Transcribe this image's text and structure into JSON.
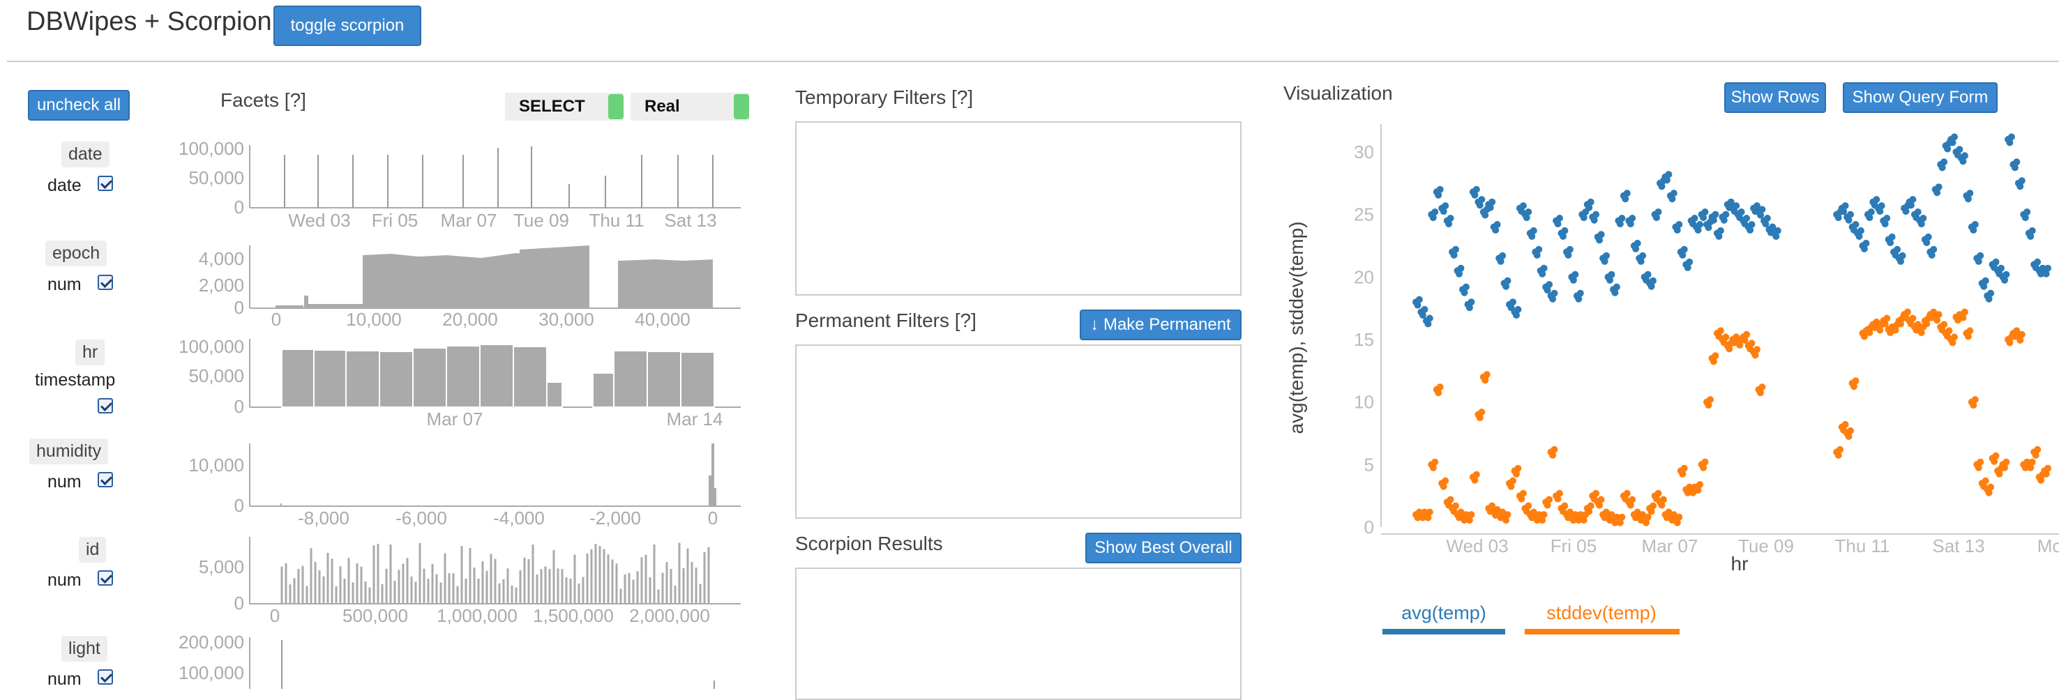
{
  "header": {
    "app_title": "DBWipes + Scorpion!",
    "toggle_button": "toggle scorpion"
  },
  "facets": {
    "uncheck_all": "uncheck all",
    "title": "Facets [?]",
    "select_toggle": "SELECT",
    "real_toggle": "Real",
    "rows": [
      {
        "name": "date",
        "type": "date",
        "checked": true,
        "yticks": [
          "100,000",
          "50,000",
          "0"
        ],
        "xticks": [
          "Wed 03",
          "Fri 05",
          "Mar 07",
          "Tue 09",
          "Thu 11",
          "Sat 13"
        ]
      },
      {
        "name": "epoch",
        "type": "num",
        "checked": true,
        "yticks": [
          "4,000",
          "2,000",
          "0"
        ],
        "xticks": [
          "0",
          "10,000",
          "20,000",
          "30,000",
          "40,000"
        ]
      },
      {
        "name": "hr",
        "type": "timestamp",
        "checked": true,
        "yticks": [
          "100,000",
          "50,000",
          "0"
        ],
        "xticks": [
          "Mar 07",
          "Mar 14"
        ]
      },
      {
        "name": "humidity",
        "type": "num",
        "checked": true,
        "yticks": [
          "10,000",
          "0"
        ],
        "xticks": [
          "-8,000",
          "-6,000",
          "-4,000",
          "-2,000",
          "0"
        ]
      },
      {
        "name": "id",
        "type": "num",
        "checked": true,
        "yticks": [
          "5,000",
          "0"
        ],
        "xticks": [
          "0",
          "500,000",
          "1,000,000",
          "1,500,000",
          "2,000,000"
        ]
      },
      {
        "name": "light",
        "type": "num",
        "checked": true,
        "yticks": [
          "200,000",
          "100,000"
        ],
        "xticks": []
      }
    ]
  },
  "filters": {
    "temporary_title": "Temporary Filters [?]",
    "permanent_title": "Permanent Filters [?]",
    "make_permanent": "↓ Make Permanent",
    "scorpion_title": "Scorpion Results",
    "show_best": "Show Best Overall"
  },
  "visualization": {
    "title": "Visualization",
    "show_rows": "Show Rows",
    "show_query_form": "Show Query Form",
    "ylabel": "avg(temp), stddev(temp)",
    "xlabel": "hr",
    "yticks": [
      "30",
      "25",
      "20",
      "15",
      "10",
      "5",
      "0"
    ],
    "xticks": [
      "Wed 03",
      "Fri 05",
      "Mar 07",
      "Tue 09",
      "Thu 11",
      "Sat 13",
      "Mon"
    ],
    "legend": [
      "avg(temp)",
      "stddev(temp)"
    ],
    "colors": {
      "avg": "#2c7bb6",
      "stddev": "#ff7f0e"
    }
  },
  "chart_data": {
    "type": "scatter",
    "xlabel": "hr",
    "ylabel": "avg(temp), stddev(temp)",
    "ylim": [
      0,
      31
    ],
    "x_categories": [
      "Wed 03",
      "Fri 05",
      "Mar 07",
      "Tue 09",
      "Thu 11",
      "Sat 13",
      "Mon"
    ],
    "series": [
      {
        "name": "avg(temp)",
        "x_days": [
          0.0,
          0.1,
          0.2,
          0.3,
          0.4,
          0.5,
          0.6,
          0.7,
          0.8,
          0.9,
          1.0,
          1.1,
          1.2,
          1.3,
          1.4,
          1.5,
          1.6,
          1.7,
          1.8,
          1.9,
          2.0,
          2.1,
          2.2,
          2.3,
          2.4,
          2.5,
          2.6,
          2.7,
          2.8,
          2.9,
          3.0,
          3.1,
          3.2,
          3.3,
          3.4,
          3.5,
          3.6,
          3.7,
          3.8,
          3.9,
          4.0,
          4.1,
          4.2,
          4.3,
          4.4,
          4.5,
          4.6,
          4.7,
          4.8,
          4.9,
          5.0,
          5.1,
          5.2,
          5.3,
          5.4,
          5.5,
          5.6,
          5.7,
          5.8,
          5.9,
          6.0,
          6.1,
          6.2,
          6.3,
          6.4,
          6.5,
          6.6,
          6.7,
          6.8,
          6.9,
          7.0,
          7.1,
          7.2,
          7.3,
          7.4,
          7.5,
          7.6,
          7.7,
          7.8,
          7.9,
          8.0,
          8.1,
          8.2,
          8.3,
          8.4,
          8.5,
          8.6,
          8.7,
          8.8,
          8.9,
          9.0,
          9.1,
          9.2,
          9.3,
          9.4,
          9.5,
          9.6,
          9.7,
          9.8,
          9.9,
          10.0,
          10.1,
          10.2,
          10.3,
          10.4,
          10.5,
          10.6,
          10.7,
          10.8,
          10.9,
          11.0,
          11.1,
          11.2,
          11.3,
          11.4,
          11.5,
          11.6,
          11.7,
          11.8,
          11.9,
          12.0,
          12.1,
          12.2,
          12.3
        ],
        "values": [
          18.0,
          17.2,
          16.5,
          25.0,
          26.8,
          25.5,
          24.5,
          22.0,
          20.5,
          19.0,
          17.8,
          26.8,
          26.0,
          25.2,
          25.8,
          24.0,
          21.5,
          19.5,
          17.8,
          17.2,
          25.5,
          25.0,
          23.5,
          22.0,
          20.5,
          19.2,
          18.5,
          24.5,
          23.5,
          22.0,
          20.0,
          18.5,
          25.0,
          25.8,
          24.8,
          23.2,
          21.5,
          20.0,
          19.0,
          24.5,
          26.5,
          24.5,
          22.5,
          21.5,
          20.0,
          19.5,
          25.0,
          27.5,
          28.0,
          26.5,
          24.0,
          22.0,
          21.0,
          24.5,
          24.0,
          25.0,
          24.2,
          24.8,
          23.5,
          24.8,
          25.8,
          25.5,
          25.0,
          24.5,
          24.0,
          25.5,
          25.2,
          24.5,
          23.8,
          23.5,
          null,
          null,
          null,
          null,
          null,
          null,
          null,
          null,
          null,
          null,
          null,
          25.0,
          25.5,
          24.8,
          24.0,
          23.5,
          22.5,
          25.0,
          26.0,
          25.5,
          24.5,
          23.0,
          22.0,
          21.5,
          25.5,
          26.0,
          25.0,
          24.5,
          23.0,
          22.0,
          27.0,
          29.0,
          30.5,
          31.0,
          30.0,
          29.5,
          26.5,
          24.0,
          21.5,
          19.5,
          18.5,
          21.0,
          20.5,
          20.0,
          31.0,
          29.0,
          27.5,
          25.0,
          23.5,
          21.0,
          20.5,
          20.5
        ]
      },
      {
        "name": "stddev(temp)",
        "x_days": [
          0.0,
          0.1,
          0.2,
          0.3,
          0.4,
          0.5,
          0.6,
          0.7,
          0.8,
          0.9,
          1.0,
          1.1,
          1.2,
          1.3,
          1.4,
          1.5,
          1.6,
          1.7,
          1.8,
          1.9,
          2.0,
          2.1,
          2.2,
          2.3,
          2.4,
          2.5,
          2.6,
          2.7,
          2.8,
          2.9,
          3.0,
          3.1,
          3.2,
          3.3,
          3.4,
          3.5,
          3.6,
          3.7,
          3.8,
          3.9,
          4.0,
          4.1,
          4.2,
          4.3,
          4.4,
          4.5,
          4.6,
          4.7,
          4.8,
          4.9,
          5.0,
          5.1,
          5.2,
          5.3,
          5.4,
          5.5,
          5.6,
          5.7,
          5.8,
          5.9,
          6.0,
          6.1,
          6.2,
          6.3,
          6.4,
          6.5,
          6.6,
          6.7,
          6.8,
          6.9,
          7.0,
          7.1,
          7.2,
          7.3,
          7.4,
          7.5,
          7.6,
          7.7,
          7.8,
          7.9,
          8.0,
          8.1,
          8.2,
          8.3,
          8.4,
          8.5,
          8.6,
          8.7,
          8.8,
          8.9,
          9.0,
          9.1,
          9.2,
          9.3,
          9.4,
          9.5,
          9.6,
          9.7,
          9.8,
          9.9,
          10.0,
          10.1,
          10.2,
          10.3,
          10.4,
          10.5,
          10.6,
          10.7,
          10.8,
          10.9,
          11.0,
          11.1,
          11.2,
          11.3,
          11.4,
          11.5,
          11.6,
          11.7,
          11.8,
          11.9,
          12.0,
          12.1,
          12.2,
          12.3
        ],
        "values": [
          1.0,
          1.0,
          1.0,
          5.0,
          11.0,
          3.5,
          2.0,
          1.5,
          1.0,
          0.8,
          0.8,
          4.0,
          9.0,
          12.0,
          1.5,
          1.2,
          1.0,
          0.8,
          3.5,
          4.5,
          2.5,
          1.5,
          1.0,
          0.8,
          0.8,
          2.0,
          6.0,
          2.5,
          1.5,
          1.0,
          0.8,
          0.8,
          0.8,
          1.5,
          2.5,
          2.0,
          1.0,
          0.8,
          0.6,
          0.6,
          2.5,
          2.0,
          1.0,
          0.8,
          0.6,
          1.5,
          2.5,
          2.0,
          1.0,
          0.8,
          0.6,
          4.5,
          3.0,
          3.0,
          3.2,
          5.0,
          10.0,
          13.5,
          15.5,
          15.0,
          14.5,
          15.0,
          14.8,
          15.2,
          14.5,
          14.0,
          11.0,
          null,
          null,
          null,
          null,
          null,
          null,
          null,
          null,
          null,
          null,
          null,
          null,
          null,
          null,
          6.0,
          8.0,
          7.5,
          11.5,
          null,
          15.5,
          15.8,
          16.2,
          16.0,
          16.5,
          15.8,
          16.0,
          16.5,
          17.0,
          16.5,
          16.0,
          15.8,
          16.5,
          17.0,
          16.8,
          16.0,
          15.5,
          15.0,
          16.8,
          17.0,
          15.5,
          10.0,
          5.0,
          3.5,
          3.0,
          5.5,
          4.5,
          5.0,
          15.0,
          15.5,
          15.2,
          5.0,
          5.0,
          6.0,
          4.0,
          4.5
        ]
      }
    ]
  }
}
